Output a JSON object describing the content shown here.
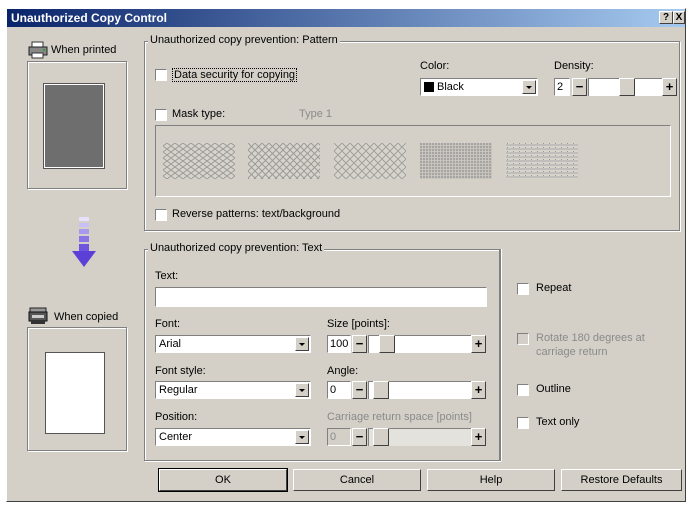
{
  "window": {
    "title": "Unauthorized Copy Control",
    "help_btn": "?",
    "close_btn": "X"
  },
  "left": {
    "when_printed": "When printed",
    "when_copied": "When copied"
  },
  "pattern_group": {
    "title": "Unauthorized copy prevention: Pattern",
    "data_security_label": "Data security for copying",
    "color_label": "Color:",
    "color_value": "Black",
    "density_label": "Density:",
    "density_value": "2",
    "minus": "−",
    "plus": "+",
    "mask_type_label": "Mask type:",
    "mask_type_value": "Type 1",
    "reverse_label": "Reverse patterns: text/background"
  },
  "text_group": {
    "title": "Unauthorized copy prevention: Text",
    "text_label": "Text:",
    "text_value": "",
    "font_label": "Font:",
    "font_value": "Arial",
    "size_label": "Size [points]:",
    "size_value": "100",
    "font_style_label": "Font style:",
    "font_style_value": "Regular",
    "angle_label": "Angle:",
    "angle_value": "0",
    "position_label": "Position:",
    "position_value": "Center",
    "carriage_label": "Carriage return space [points]",
    "carriage_value": "0",
    "minus": "−",
    "plus": "+",
    "repeat_label": "Repeat",
    "rotate_label_1": "Rotate 180 degrees at",
    "rotate_label_2": "carriage return",
    "outline_label": "Outline",
    "text_only_label": "Text only"
  },
  "buttons": {
    "ok": "OK",
    "cancel": "Cancel",
    "help": "Help",
    "restore": "Restore Defaults"
  },
  "colors": {
    "face": "#d4d0c8",
    "title_start": "#0a246a",
    "title_end": "#a6caf0",
    "arrow": "#5b3fd6",
    "swatch": "#000000"
  },
  "icons": {
    "printer": "printer-icon",
    "copier": "copier-icon",
    "down_arrow": "down-arrow-icon",
    "dropdown": "chevron-down-icon"
  }
}
